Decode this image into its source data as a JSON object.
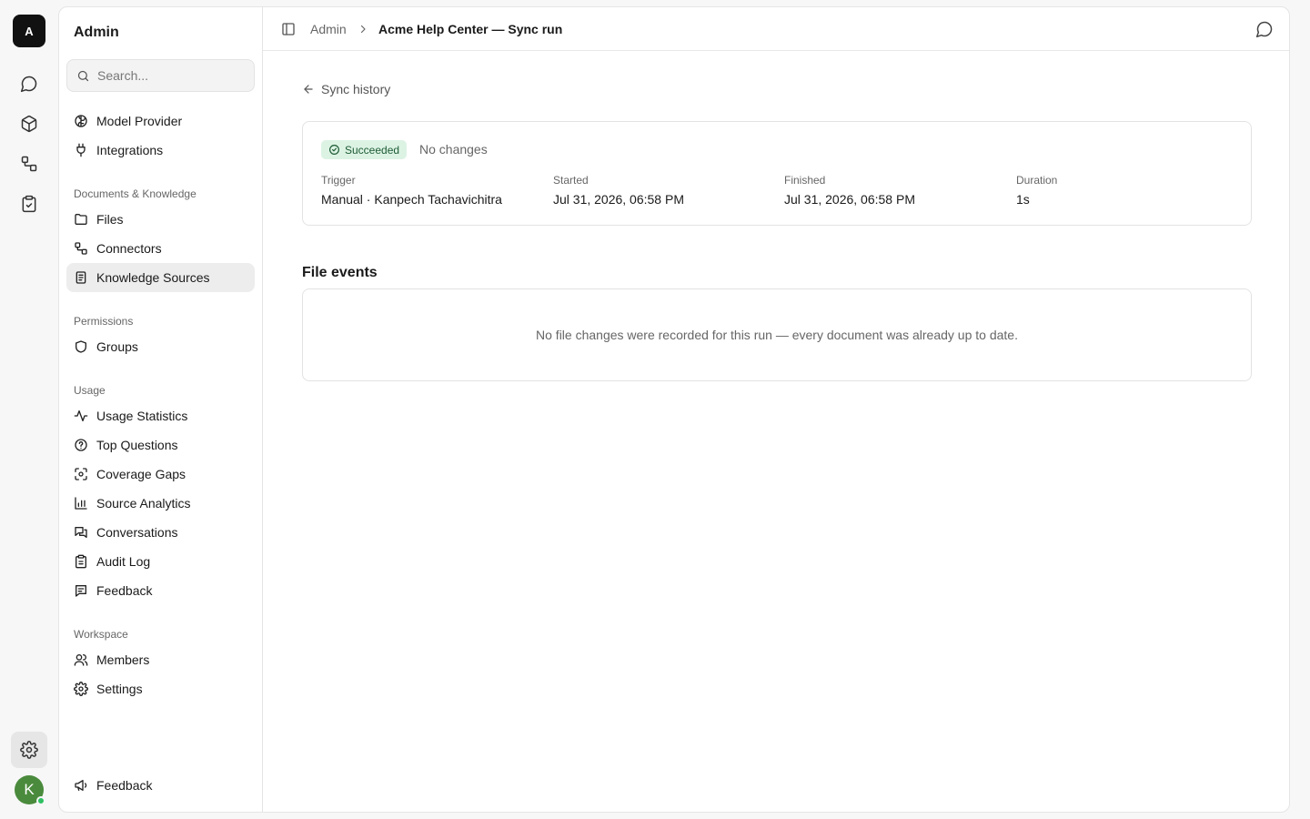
{
  "rail": {
    "logo": "A",
    "avatar": "K",
    "icons": [
      "chat-icon",
      "cube-icon",
      "connectors-icon",
      "clipboard-check-icon",
      "gear-icon"
    ]
  },
  "sidebar": {
    "title": "Admin",
    "search_placeholder": "Search...",
    "top_items": [
      {
        "label": "Model Provider",
        "icon": "brain-icon"
      },
      {
        "label": "Integrations",
        "icon": "plug-icon"
      }
    ],
    "sections": {
      "documents": {
        "label": "Documents & Knowledge",
        "items": [
          {
            "label": "Files",
            "icon": "folder-icon"
          },
          {
            "label": "Connectors",
            "icon": "connectors-icon"
          },
          {
            "label": "Knowledge Sources",
            "icon": "book-icon",
            "active": true
          }
        ]
      },
      "permissions": {
        "label": "Permissions",
        "items": [
          {
            "label": "Groups",
            "icon": "shield-icon"
          }
        ]
      },
      "usage": {
        "label": "Usage",
        "items": [
          {
            "label": "Usage Statistics",
            "icon": "activity-icon"
          },
          {
            "label": "Top Questions",
            "icon": "question-circle-icon"
          },
          {
            "label": "Coverage Gaps",
            "icon": "scan-icon"
          },
          {
            "label": "Source Analytics",
            "icon": "bar-chart-icon"
          },
          {
            "label": "Conversations",
            "icon": "messages-icon"
          },
          {
            "label": "Audit Log",
            "icon": "clipboard-icon"
          },
          {
            "label": "Feedback",
            "icon": "message-square-text-icon"
          }
        ]
      },
      "workspace": {
        "label": "Workspace",
        "items": [
          {
            "label": "Members",
            "icon": "users-icon"
          },
          {
            "label": "Settings",
            "icon": "gear-icon"
          }
        ]
      }
    },
    "footer_item": {
      "label": "Feedback",
      "icon": "megaphone-icon"
    }
  },
  "topbar": {
    "crumb_root": "Admin",
    "crumb_current": "Acme Help Center — Sync run"
  },
  "content": {
    "back_label": "Sync history",
    "status": {
      "badge": "Succeeded",
      "note": "No changes",
      "badge_bg": "#dcf3e4",
      "badge_fg": "#1e5b34"
    },
    "meta": {
      "trigger_label": "Trigger",
      "trigger_value": "Manual · Kanpech Tachavichitra",
      "started_label": "Started",
      "started_value": "Jul 31, 2026, 06:58 PM",
      "finished_label": "Finished",
      "finished_value": "Jul 31, 2026, 06:58 PM",
      "duration_label": "Duration",
      "duration_value": "1s"
    },
    "file_events": {
      "title": "File events",
      "empty_message": "No file changes were recorded for this run — every document was already up to date."
    }
  }
}
